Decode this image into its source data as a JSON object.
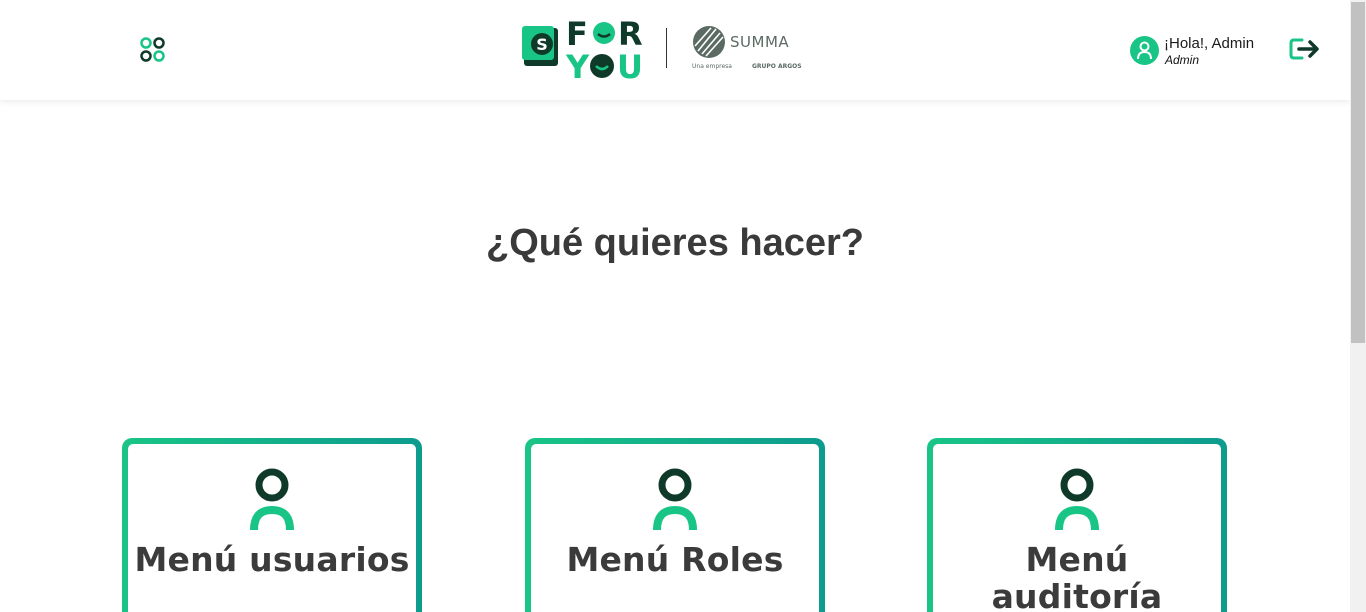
{
  "header": {
    "apps_icon": "apps-grid-icon",
    "logo_primary": "FOR YOU",
    "logo_badge": "S",
    "logo_secondary": "SUMMA",
    "logo_secondary_tagline": "Una empresa",
    "logo_secondary_group": "GRUPO ARGOS",
    "greeting": "¡Hola!, Admin",
    "role": "Admin",
    "avatar_icon": "user-icon",
    "logout_icon": "logout-icon"
  },
  "main": {
    "question": "¿Qué quieres hacer?",
    "cards": [
      {
        "label": "Menú usuarios",
        "icon": "user-icon"
      },
      {
        "label": "Menú Roles",
        "icon": "user-icon"
      },
      {
        "label": "Menú auditoría",
        "icon": "user-icon"
      }
    ]
  },
  "colors": {
    "accent": "#19c586",
    "accent_dark": "#0d9b8e",
    "dark_green": "#0f3a2a",
    "text": "#3b3b3b"
  }
}
